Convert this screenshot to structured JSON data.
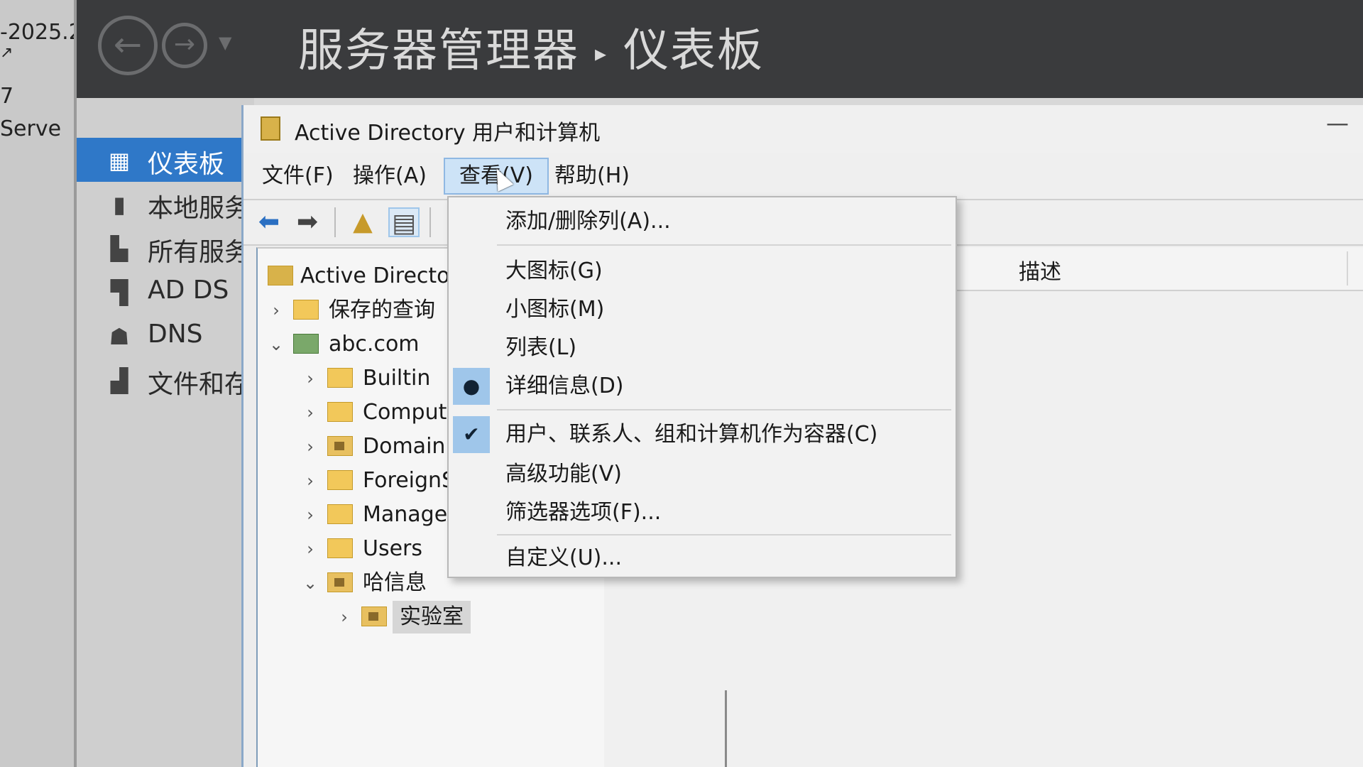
{
  "left_sliver": {
    "lines": [
      "-2025.2",
      "7",
      "7",
      "Serve"
    ]
  },
  "server_manager": {
    "title": "服务器管理器",
    "page": "仪表板",
    "separator": "▸",
    "nav": {
      "back_icon": "back-arrow-icon",
      "forward_icon": "forward-arrow-icon"
    },
    "sidebar": {
      "items": [
        {
          "label": "仪表板",
          "icon": "dashboard-icon",
          "active": true
        },
        {
          "label": "本地服务",
          "icon": "local-server-icon",
          "active": false
        },
        {
          "label": "所有服务",
          "icon": "all-servers-icon",
          "active": false
        },
        {
          "label": "AD DS",
          "icon": "ad-ds-icon",
          "active": false
        },
        {
          "label": "DNS",
          "icon": "dns-icon",
          "active": false
        },
        {
          "label": "文件和存",
          "icon": "file-storage-icon",
          "active": false
        }
      ]
    }
  },
  "aduc": {
    "title": "Active Directory 用户和计算机",
    "minimize": "—",
    "menu": {
      "file": "文件(F)",
      "action": "操作(A)",
      "view": "查看(V)",
      "help": "帮助(H)"
    },
    "toolbar": [
      "back-icon",
      "forward-icon",
      "up-folder-icon",
      "show-tree-icon"
    ],
    "tree": [
      {
        "label": "Active Director",
        "chevron": "",
        "icon": "root"
      },
      {
        "label": "保存的查询",
        "chevron": ">",
        "icon": "folder"
      },
      {
        "label": "abc.com",
        "chevron": "v",
        "icon": "domain"
      },
      {
        "label": "Builtin",
        "chevron": ">",
        "icon": "folder"
      },
      {
        "label": "Comput",
        "chevron": ">",
        "icon": "folder"
      },
      {
        "label": "Domain",
        "chevron": ">",
        "icon": "ou"
      },
      {
        "label": "ForeignS",
        "chevron": ">",
        "icon": "folder"
      },
      {
        "label": "Manage",
        "chevron": ">",
        "icon": "folder"
      },
      {
        "label": "Users",
        "chevron": ">",
        "icon": "folder"
      },
      {
        "label": "哈信息",
        "chevron": "v",
        "icon": "ou"
      },
      {
        "label": "实验室",
        "chevron": ">",
        "icon": "ou",
        "selected": true
      }
    ],
    "details": {
      "column_description": "描述"
    },
    "view_menu": {
      "items": [
        {
          "label": "添加/删除列(A)...",
          "mark": ""
        },
        {
          "label": "大图标(G)",
          "mark": ""
        },
        {
          "label": "小图标(M)",
          "mark": ""
        },
        {
          "label": "列表(L)",
          "mark": ""
        },
        {
          "label": "详细信息(D)",
          "mark": "●"
        },
        {
          "label": "用户、联系人、组和计算机作为容器(C)",
          "mark": "✔"
        },
        {
          "label": "高级功能(V)",
          "mark": ""
        },
        {
          "label": "筛选器选项(F)...",
          "mark": ""
        },
        {
          "label": "自定义(U)...",
          "mark": ""
        }
      ]
    }
  },
  "colors": {
    "accent": "#2f78c8",
    "menu_highlight": "#9fc6ea",
    "header_bg": "#3a3b3d"
  }
}
